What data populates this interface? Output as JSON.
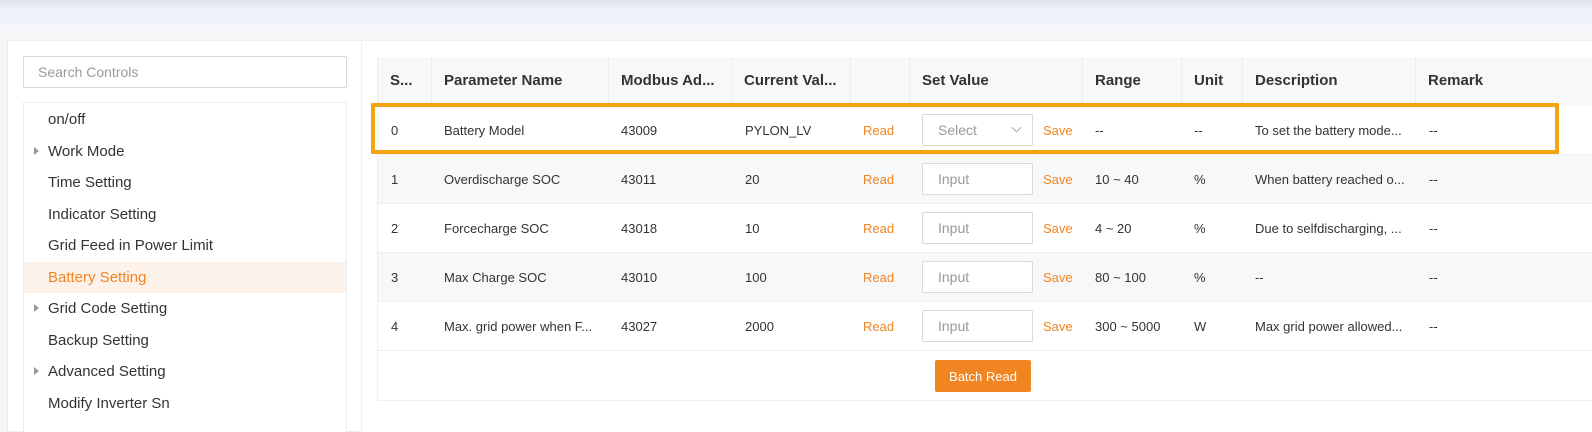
{
  "search": {
    "placeholder": "Search Controls"
  },
  "menu": {
    "items": [
      {
        "label": "on/off",
        "expandable": false,
        "active": false
      },
      {
        "label": "Work Mode",
        "expandable": true,
        "active": false
      },
      {
        "label": "Time Setting",
        "expandable": false,
        "active": false
      },
      {
        "label": "Indicator Setting",
        "expandable": false,
        "active": false
      },
      {
        "label": "Grid Feed in Power Limit",
        "expandable": false,
        "active": false
      },
      {
        "label": "Battery Setting",
        "expandable": false,
        "active": true
      },
      {
        "label": "Grid Code Setting",
        "expandable": true,
        "active": false
      },
      {
        "label": "Backup Setting",
        "expandable": false,
        "active": false
      },
      {
        "label": "Advanced Setting",
        "expandable": true,
        "active": false
      },
      {
        "label": "Modify Inverter Sn",
        "expandable": false,
        "active": false
      }
    ]
  },
  "table": {
    "headers": [
      "S...",
      "Parameter Name",
      "Modbus Ad...",
      "Current Val...",
      "",
      "Set Value",
      "Range",
      "Unit",
      "Description",
      "Remark"
    ],
    "rows": [
      {
        "sn": "0",
        "name": "Battery Model",
        "modbus": "43009",
        "current": "PYLON_LV",
        "read": "Read",
        "control": "select",
        "placeholder": "Select",
        "save": "Save",
        "range": "--",
        "unit": "--",
        "description": "To set the battery mode...",
        "remark": "--"
      },
      {
        "sn": "1",
        "name": "Overdischarge SOC",
        "modbus": "43011",
        "current": "20",
        "read": "Read",
        "control": "input",
        "placeholder": "Input",
        "save": "Save",
        "range": "10 ~ 40",
        "unit": "%",
        "description": "When battery reached o...",
        "remark": "--"
      },
      {
        "sn": "2",
        "name": "Forcecharge SOC",
        "modbus": "43018",
        "current": "10",
        "read": "Read",
        "control": "input",
        "placeholder": "Input",
        "save": "Save",
        "range": "4 ~ 20",
        "unit": "%",
        "description": "Due to selfdischarging, ...",
        "remark": "--"
      },
      {
        "sn": "3",
        "name": "Max Charge SOC",
        "modbus": "43010",
        "current": "100",
        "read": "Read",
        "control": "input",
        "placeholder": "Input",
        "save": "Save",
        "range": "80 ~ 100",
        "unit": "%",
        "description": "--",
        "remark": "--"
      },
      {
        "sn": "4",
        "name": "Max. grid power when F...",
        "modbus": "43027",
        "current": "2000",
        "read": "Read",
        "control": "input",
        "placeholder": "Input",
        "save": "Save",
        "range": "300 ~ 5000",
        "unit": "W",
        "description": "Max grid power allowed...",
        "remark": "--"
      }
    ]
  },
  "batch_read_label": "Batch Read",
  "colors": {
    "accent": "#f08522",
    "highlight": "#f6a312"
  }
}
